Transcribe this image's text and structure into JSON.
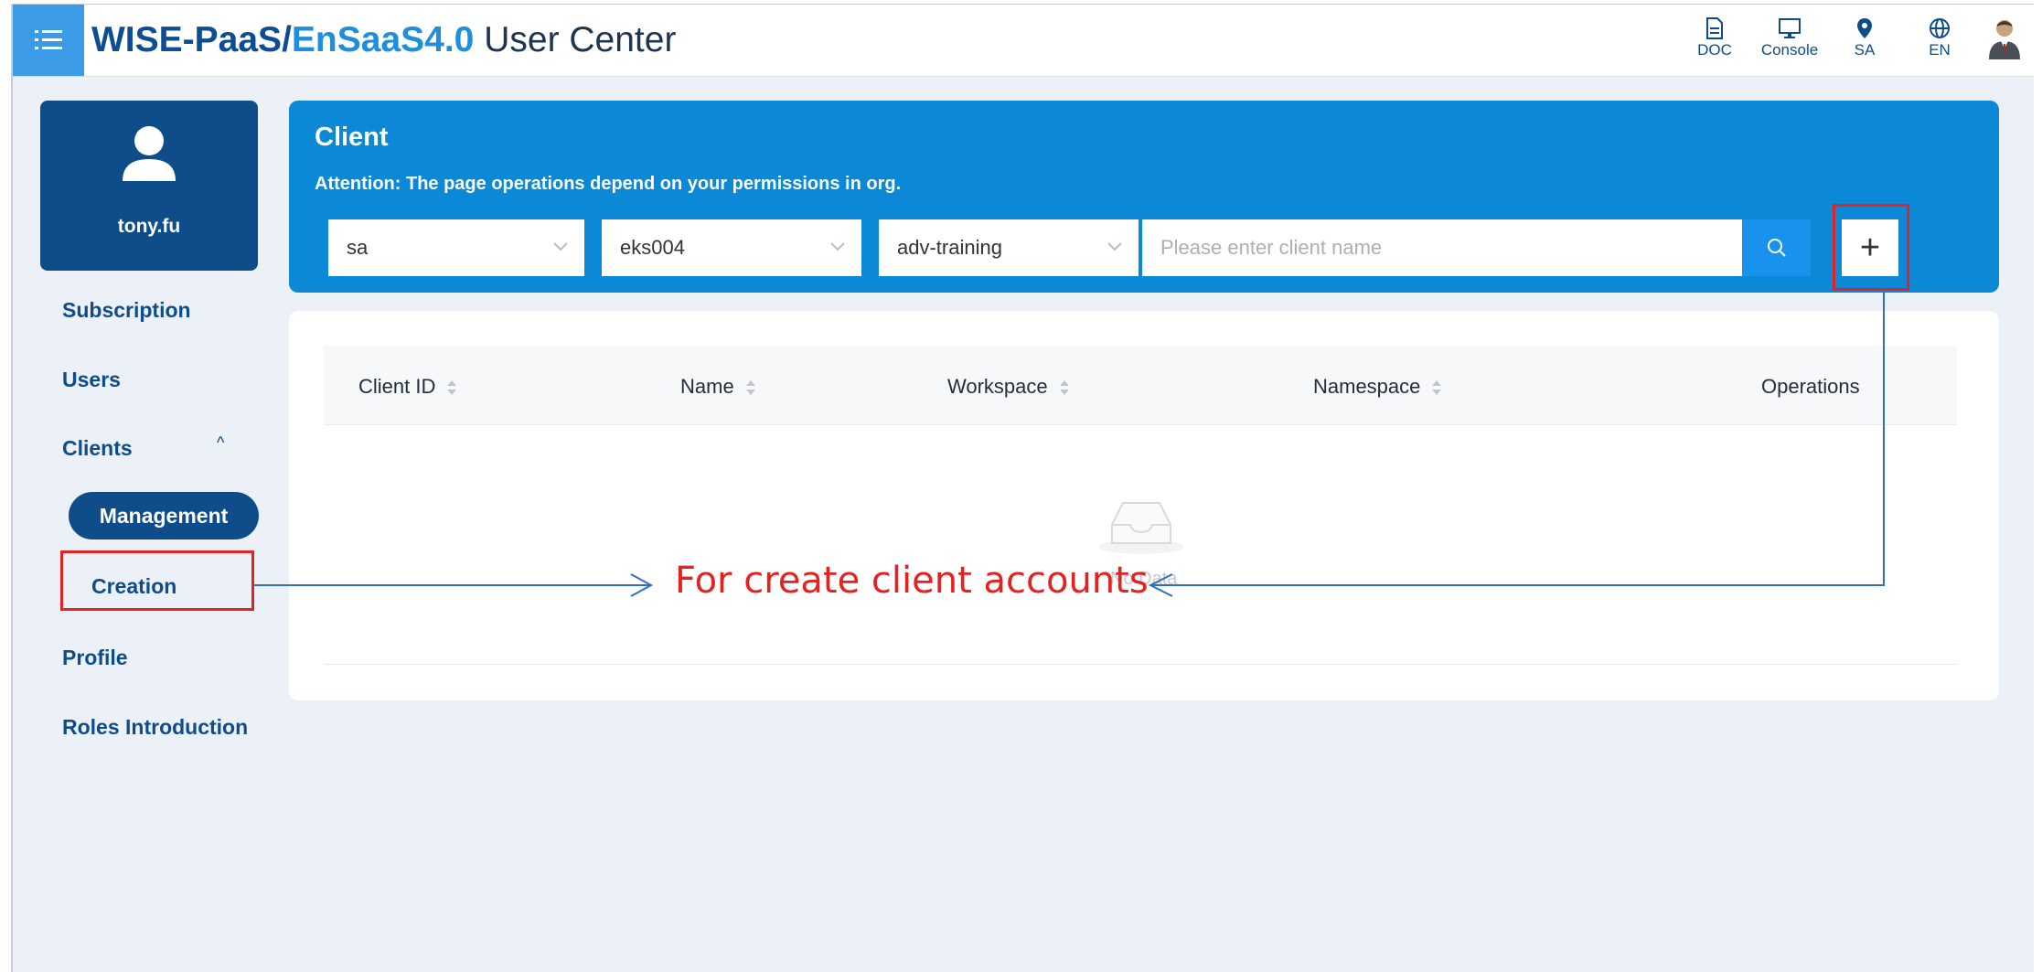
{
  "header": {
    "brand_part1": "WISE-PaaS/",
    "brand_part2": "EnSaaS4.0",
    "brand_part3": " User Center",
    "tools": [
      {
        "label": "DOC",
        "icon": "document-icon"
      },
      {
        "label": "Console",
        "icon": "monitor-icon"
      },
      {
        "label": "SA",
        "icon": "location-pin-icon"
      },
      {
        "label": "EN",
        "icon": "globe-icon"
      }
    ]
  },
  "sidebar": {
    "username": "tony.fu",
    "items": [
      {
        "label": "Subscription"
      },
      {
        "label": "Users"
      },
      {
        "label": "Clients"
      },
      {
        "label": "Profile"
      },
      {
        "label": "Roles Introduction"
      }
    ],
    "clients_sub": [
      {
        "label": "Management",
        "active": true
      },
      {
        "label": "Creation",
        "active": false
      }
    ],
    "caret": "^"
  },
  "client": {
    "title": "Client",
    "attention": "Attention: The page operations depend on your permissions in org.",
    "filters": [
      {
        "value": "sa"
      },
      {
        "value": "eks004"
      },
      {
        "value": "adv-training"
      }
    ],
    "search_placeholder": "Please enter client name",
    "add_label": "+"
  },
  "table": {
    "columns": [
      "Client ID",
      "Name",
      "Workspace",
      "Namespace",
      "Operations"
    ],
    "rows": [],
    "empty_text": "No Data"
  },
  "annotation": {
    "text": "For create client accounts"
  },
  "colors": {
    "brand_dark": "#0f4d8a",
    "brand_light": "#1f8fdc",
    "panel_blue": "#0b89d6",
    "highlight_red": "#e52222"
  }
}
